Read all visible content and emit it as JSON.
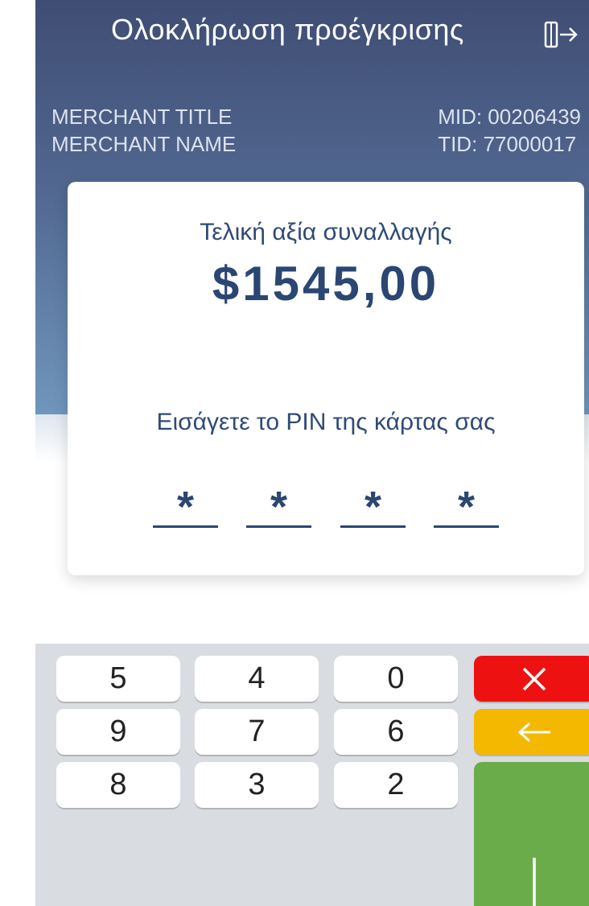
{
  "header": {
    "title": "Ολοκλήρωση προέγκρισης",
    "exit_icon": "exit-door-icon"
  },
  "merchant": {
    "title": "MERCHANT TITLE",
    "name": "MERCHANT NAME",
    "mid": "MID: 00206439",
    "tid": "TID: 77000017"
  },
  "transaction": {
    "amount_label": "Τελική αξία συναλλαγής",
    "amount": "$1545,00"
  },
  "pin": {
    "label": "Εισάγετε το PIN της κάρτας σας",
    "digits": [
      "*",
      "*",
      "*",
      "*"
    ]
  },
  "keypad": {
    "keys": [
      "5",
      "4",
      "0",
      "9",
      "7",
      "6",
      "8",
      "3",
      "2"
    ],
    "cancel_icon": "close-icon",
    "backspace_icon": "arrow-left-icon",
    "confirm_icon": "enter-icon",
    "colors": {
      "cancel": "#ee1111",
      "backspace": "#f5b800",
      "confirm": "#6aac4a"
    }
  }
}
